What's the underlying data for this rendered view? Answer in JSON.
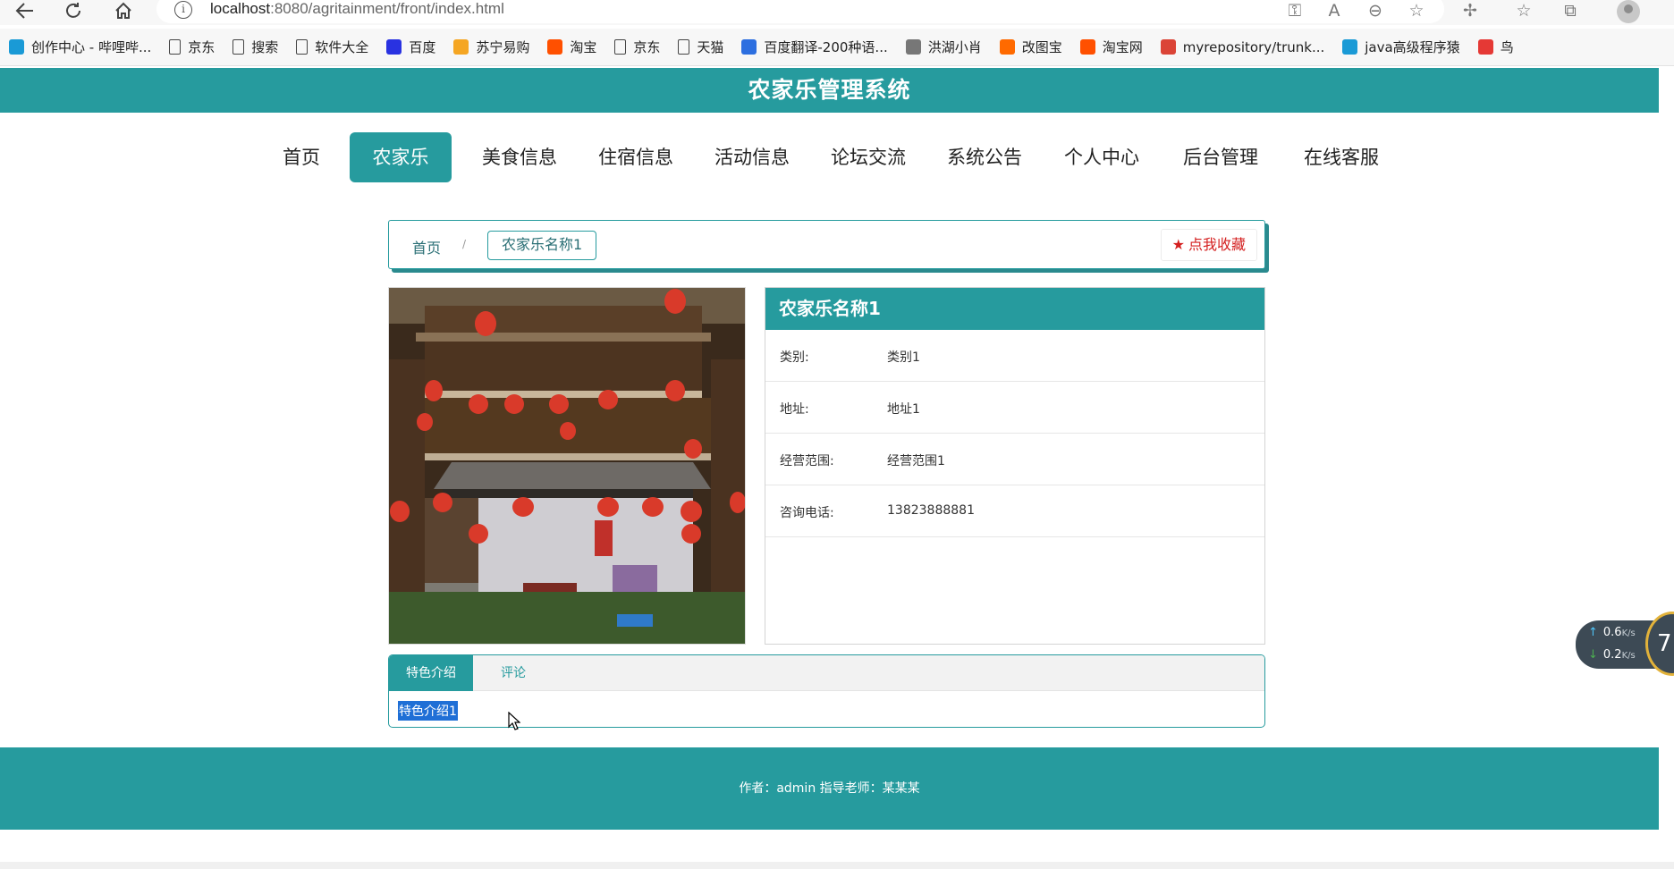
{
  "browser": {
    "url_host": "localhost",
    "url_rest": ":8080/agritainment/front/index.html",
    "bookmarks": [
      {
        "label": "创作中心 - 哔哩哔...",
        "icon": "bilibili-icon",
        "color": "#1a9ad6"
      },
      {
        "label": "京东",
        "icon": "page-icon"
      },
      {
        "label": "搜索",
        "icon": "page-icon"
      },
      {
        "label": "软件大全",
        "icon": "page-icon"
      },
      {
        "label": "百度",
        "icon": "baidu-icon",
        "color": "#2932e1"
      },
      {
        "label": "苏宁易购",
        "icon": "suning-icon",
        "color": "#f5a623"
      },
      {
        "label": "淘宝",
        "icon": "taobao-icon",
        "color": "#ff5000"
      },
      {
        "label": "京东",
        "icon": "page-icon"
      },
      {
        "label": "天猫",
        "icon": "page-icon"
      },
      {
        "label": "百度翻译-200种语...",
        "icon": "translate-icon",
        "color": "#2d6fe0"
      },
      {
        "label": "洪湖小肖",
        "icon": "bird-icon",
        "color": "#777777"
      },
      {
        "label": "改图宝",
        "icon": "gaitubao-icon",
        "color": "#ff6a00"
      },
      {
        "label": "淘宝网",
        "icon": "taobao-icon",
        "color": "#ff5000"
      },
      {
        "label": "myrepository/trunk...",
        "icon": "chrome-icon",
        "color": "#db4437"
      },
      {
        "label": "java高级程序猿",
        "icon": "bilibili-icon",
        "color": "#1a9ad6"
      },
      {
        "label": "鸟",
        "icon": "bird-icon",
        "color": "#e53935"
      }
    ]
  },
  "site": {
    "title": "农家乐管理系统",
    "nav": [
      "首页",
      "农家乐",
      "美食信息",
      "住宿信息",
      "活动信息",
      "论坛交流",
      "系统公告",
      "个人中心",
      "后台管理",
      "在线客服"
    ],
    "active_nav": "农家乐"
  },
  "breadcrumb": {
    "home": "首页",
    "separator": "/",
    "current": "农家乐名称1",
    "favorite": "点我收藏"
  },
  "detail": {
    "name": "农家乐名称1",
    "rows": [
      {
        "label": "类别:",
        "value": "类别1"
      },
      {
        "label": "地址:",
        "value": "地址1"
      },
      {
        "label": "经营范围:",
        "value": "经营范围1"
      },
      {
        "label": "咨询电话:",
        "value": "13823888881"
      }
    ]
  },
  "tabs": {
    "items": [
      "特色介绍",
      "评论"
    ],
    "active": "特色介绍",
    "content": "特色介绍1"
  },
  "footer": {
    "text": "作者：admin 指导老师：某某某"
  },
  "netspeed": {
    "up": "0.6",
    "down": "0.2",
    "unit": "K/s",
    "badge": "7"
  },
  "colors": {
    "primary": "#269b9e",
    "favorite": "#d41f1f"
  }
}
